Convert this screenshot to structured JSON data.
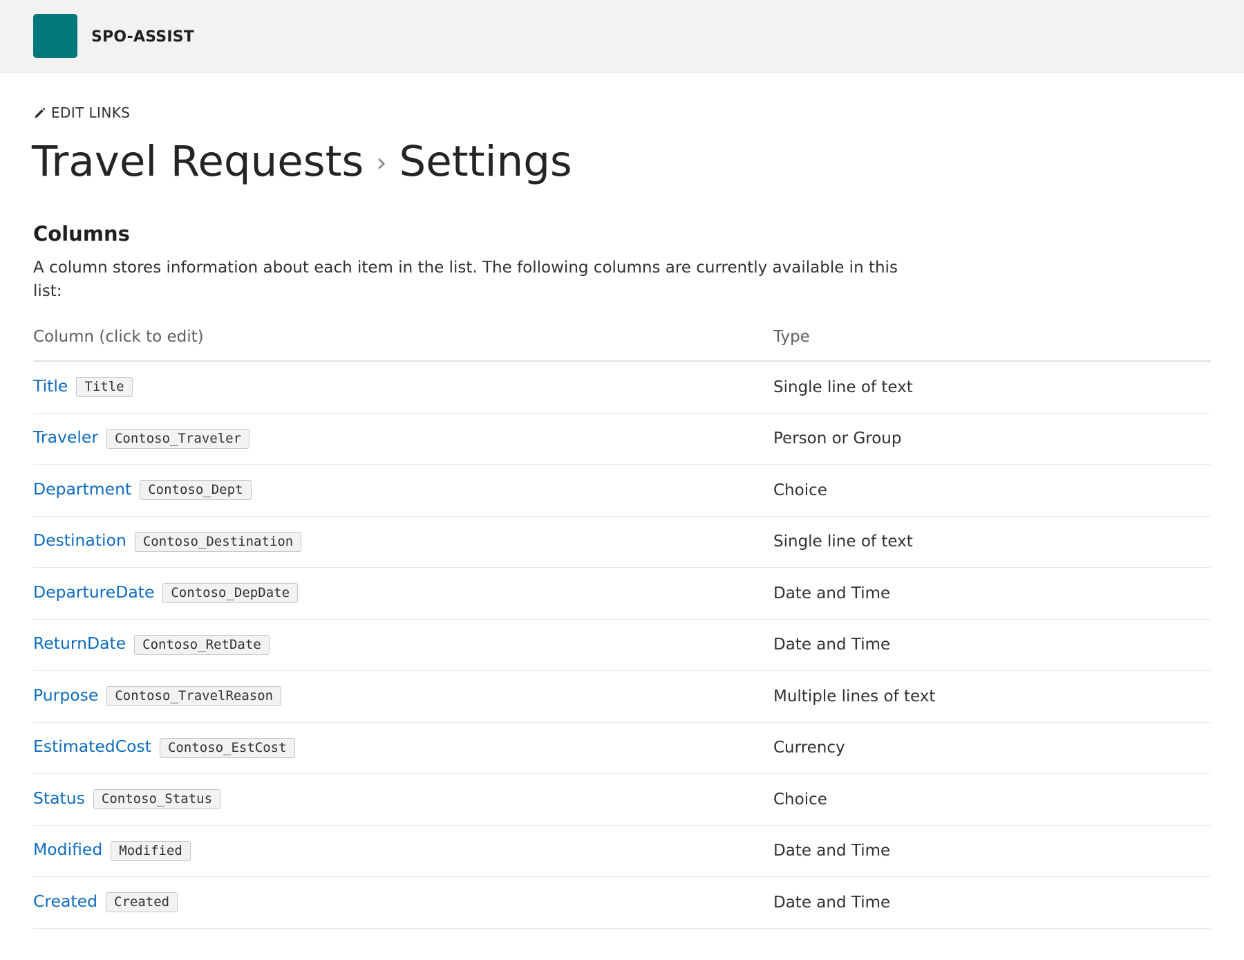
{
  "header": {
    "site_name": "SPO-ASSIST",
    "logo_color": "#03787c"
  },
  "edit_links": {
    "icon": "pencil-icon",
    "label": "EDIT LINKS"
  },
  "breadcrumb": {
    "list_name": "Travel Requests",
    "separator": "›",
    "page_name": "Settings"
  },
  "columns_section": {
    "heading": "Columns",
    "description": "A column stores information about each item in the list. The following columns are currently available in this list:",
    "table": {
      "headers": {
        "column": "Column (click to edit)",
        "type": "Type"
      },
      "rows": [
        {
          "name": "Title",
          "internal": "Title",
          "type": "Single line of text"
        },
        {
          "name": "Traveler",
          "internal": "Contoso_Traveler",
          "type": "Person or Group"
        },
        {
          "name": "Department",
          "internal": "Contoso_Dept",
          "type": "Choice"
        },
        {
          "name": "Destination",
          "internal": "Contoso_Destination",
          "type": "Single line of text"
        },
        {
          "name": "DepartureDate",
          "internal": "Contoso_DepDate",
          "type": "Date and Time"
        },
        {
          "name": "ReturnDate",
          "internal": "Contoso_RetDate",
          "type": "Date and Time"
        },
        {
          "name": "Purpose",
          "internal": "Contoso_TravelReason",
          "type": "Multiple lines of text"
        },
        {
          "name": "EstimatedCost",
          "internal": "Contoso_EstCost",
          "type": "Currency"
        },
        {
          "name": "Status",
          "internal": "Contoso_Status",
          "type": "Choice"
        },
        {
          "name": "Modified",
          "internal": "Modified",
          "type": "Date and Time"
        },
        {
          "name": "Created",
          "internal": "Created",
          "type": "Date and Time"
        }
      ]
    }
  },
  "colors": {
    "link": "#0f6cbd",
    "suite_bar_bg": "#f3f2f1"
  }
}
